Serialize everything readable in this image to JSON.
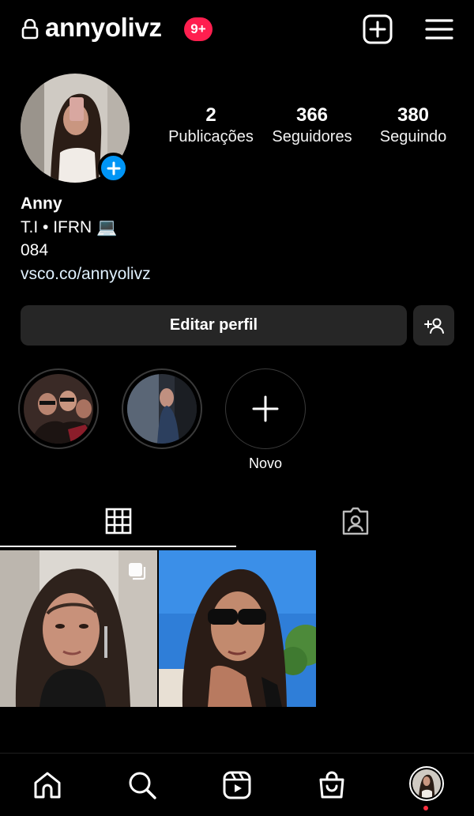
{
  "header": {
    "username": "annyolivz",
    "notification_badge": "9+",
    "lock_icon": "lock-icon",
    "create_icon": "plus-square-icon",
    "menu_icon": "hamburger-menu-icon"
  },
  "profile": {
    "stats": [
      {
        "value": "2",
        "label": "Publicações"
      },
      {
        "value": "366",
        "label": "Seguidores"
      },
      {
        "value": "380",
        "label": "Seguindo"
      }
    ],
    "name": "Anny",
    "bio_line1": "T.I • IFRN 💻",
    "bio_line2": "084",
    "link": "vsco.co/annyolivz"
  },
  "actions": {
    "edit_profile": "Editar perfil",
    "discover_icon": "add-person-icon"
  },
  "highlights": {
    "new_label": "Novo"
  },
  "tabs": {
    "grid_icon": "grid-icon",
    "tagged_icon": "tagged-person-icon"
  },
  "bottom_nav": {
    "items": [
      "home-icon",
      "search-icon",
      "reels-icon",
      "shop-icon",
      "profile-avatar"
    ]
  },
  "colors": {
    "background": "#000000",
    "badge": "#ff1f4f",
    "accent_blue": "#0095f6",
    "button_bg": "#262626"
  }
}
